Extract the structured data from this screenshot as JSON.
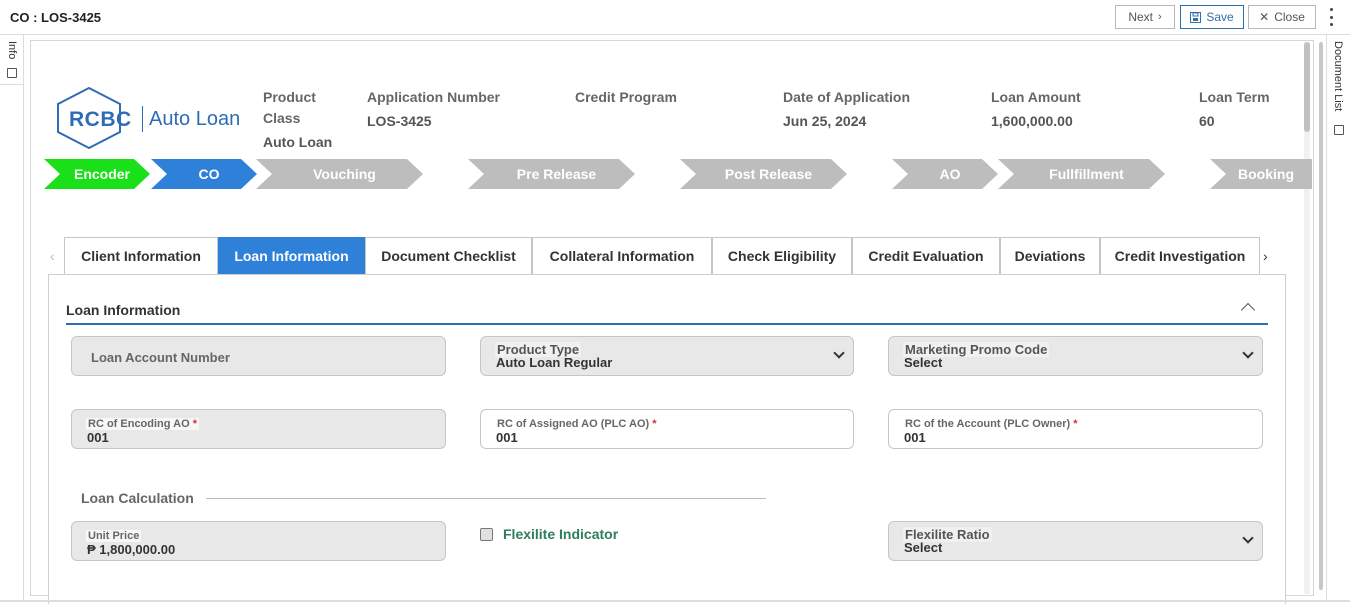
{
  "window": {
    "title": "CO : LOS-3425"
  },
  "toolbar": {
    "next_label": "Next",
    "save_label": "Save",
    "close_label": "Close"
  },
  "rails": {
    "left_label": "Info",
    "right_label": "Document List"
  },
  "logo": {
    "brand": "RCBC",
    "product": "Auto Loan"
  },
  "header": {
    "product_class_label_1": "Product",
    "product_class_label_2": "Class",
    "product_class_value": "Auto Loan",
    "application_number_label": "Application Number",
    "application_number_value": "LOS-3425",
    "credit_program_label": "Credit Program",
    "credit_program_value": "",
    "date_label": "Date of Application",
    "date_value": "Jun 25, 2024",
    "loan_amount_label": "Loan Amount",
    "loan_amount_value": "1,600,000.00",
    "loan_term_label": "Loan Term",
    "loan_term_value": "60"
  },
  "stages": [
    "Encoder",
    "CO",
    "Vouching",
    "Pre Release",
    "Post Release",
    "AO",
    "Fullfillment",
    "Booking"
  ],
  "tabs": [
    "Client Information",
    "Loan Information",
    "Document Checklist",
    "Collateral Information",
    "Check Eligibility",
    "Credit Evaluation",
    "Deviations",
    "Credit Investigation"
  ],
  "section": {
    "title": "Loan Information",
    "loan_account_number_placeholder": "Loan Account Number",
    "product_type_label": "Product Type",
    "product_type_value": "Auto Loan Regular",
    "promo_code_label": "Marketing Promo Code",
    "promo_code_value": "Select",
    "rc_encoding_label": "RC of Encoding AO",
    "rc_encoding_value": "001",
    "rc_assigned_label": "RC of Assigned AO (PLC AO)",
    "rc_assigned_value": "001",
    "rc_account_label": "RC of the Account (PLC Owner)",
    "rc_account_value": "001",
    "required_mark": "*",
    "loan_calc_title": "Loan Calculation",
    "unit_price_label": "Unit Price",
    "unit_price_value": "₱ 1,800,000.00",
    "flexilite_indicator_label": "Flexilite Indicator",
    "flexilite_ratio_label": "Flexilite Ratio",
    "flexilite_ratio_value": "Select"
  },
  "colors": {
    "accent": "#2f80d8",
    "encoder_stage": "#19e019",
    "brand": "#2e6db4"
  }
}
